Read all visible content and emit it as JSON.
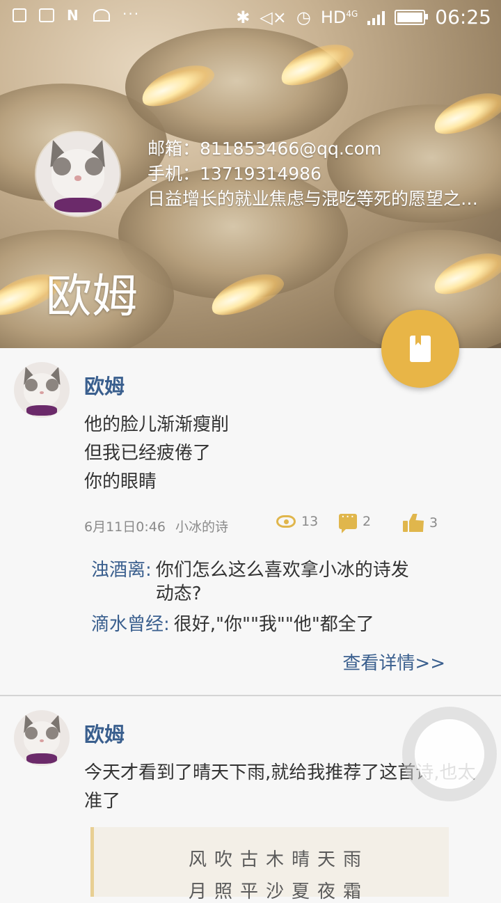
{
  "status_bar": {
    "network": "HD",
    "network_sub": "4G",
    "time": "06:25"
  },
  "profile": {
    "email_line": "邮箱：811853466@qq.com",
    "phone_line": "手机：13719314986",
    "bio": "日益增长的就业焦虑与混吃等死的愿望之间的矛盾",
    "name": "欧姆"
  },
  "posts": [
    {
      "author": "欧姆",
      "lines": [
        "他的脸儿渐渐瘦削",
        "但我已经疲倦了",
        "你的眼睛"
      ],
      "date": "6月11日0:46",
      "source": "小冰的诗",
      "views": "13",
      "comments_count": "2",
      "likes": "3",
      "comments": [
        {
          "user": "浊酒离:",
          "text": "你们怎么这么喜欢拿小冰的诗发动态?"
        },
        {
          "user": "滴水曾经:",
          "text": "很好,\"你\"\"我\"\"他\"都全了"
        }
      ],
      "details_link": "查看详情>>"
    },
    {
      "author": "欧姆",
      "text": "今天才看到了晴天下雨,就给我推荐了这首诗,也太准了",
      "quote_lines": [
        "风吹古木晴天雨",
        "月照平沙夏夜霜"
      ]
    }
  ],
  "colors": {
    "accent": "#e8b547",
    "link": "#3a5f8e"
  }
}
